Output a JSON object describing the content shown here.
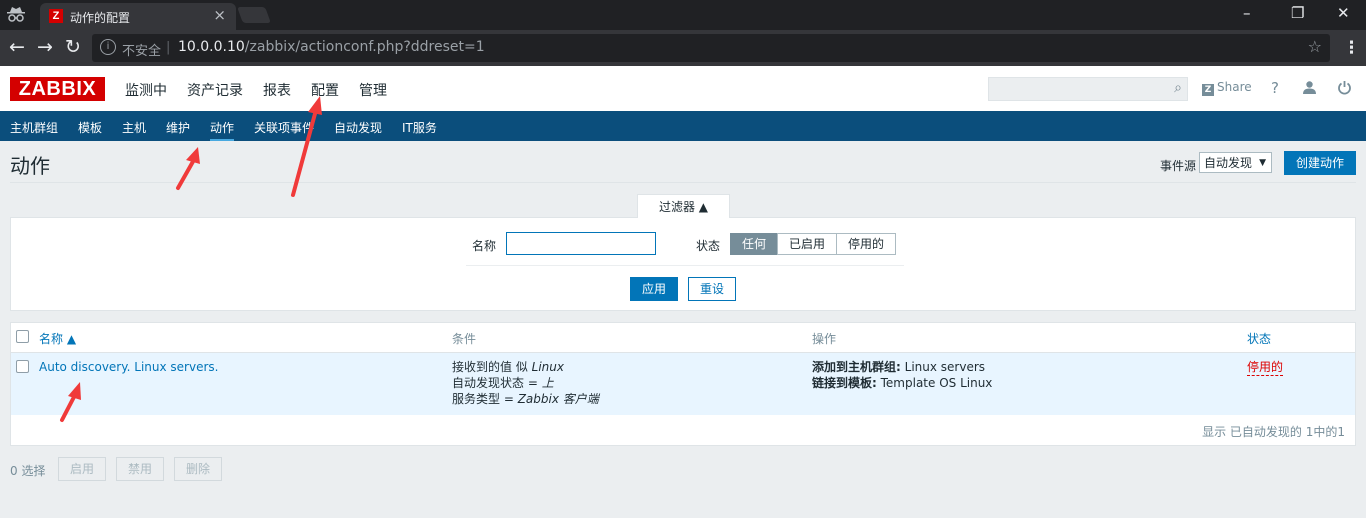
{
  "browser": {
    "tab_title": "动作的配置",
    "favicon_letter": "Z",
    "tab_close": "×",
    "url_security": "不安全",
    "url_host": "10.0.0.10",
    "url_path": "/zabbix/actionconf.php?ddreset=1",
    "window_controls": [
      "–",
      "❐",
      "✕"
    ]
  },
  "header": {
    "logo": "ZABBIX",
    "menu": [
      "监测中",
      "资产记录",
      "报表",
      "配置",
      "管理"
    ],
    "share": "Share",
    "share_icon": "Z",
    "help": "?"
  },
  "subnav": {
    "items": [
      "主机群组",
      "模板",
      "主机",
      "维护",
      "动作",
      "关联项事件",
      "自动发现",
      "IT服务"
    ],
    "active": "动作"
  },
  "page": {
    "title": "动作",
    "event_source_label": "事件源",
    "event_source_value": "自动发现",
    "create_button": "创建动作"
  },
  "filter": {
    "tab_label": "过滤器 ▲",
    "name_label": "名称",
    "name_value": "",
    "status_label": "状态",
    "status_options": [
      "任何",
      "已启用",
      "停用的"
    ],
    "status_selected": "任何",
    "apply": "应用",
    "reset": "重设"
  },
  "table": {
    "columns": [
      "名称 ▲",
      "条件",
      "操作",
      "状态"
    ],
    "rows": [
      {
        "name": "Auto discovery. Linux servers.",
        "conditions": [
          {
            "text": "接收到的值 似 ",
            "value": "Linux"
          },
          {
            "text": "自动发现状态 = ",
            "value": "上"
          },
          {
            "text": "服务类型 = ",
            "value": "Zabbix 客户端"
          }
        ],
        "operations": [
          {
            "label": "添加到主机群组:",
            "value": " Linux servers"
          },
          {
            "label": "链接到模板:",
            "value": " Template OS Linux"
          }
        ],
        "status": "停用的"
      }
    ],
    "footer": "显示 已自动发现的 1中的1"
  },
  "mass_actions": {
    "selected": "0 选择",
    "buttons": [
      "启用",
      "禁用",
      "删除"
    ]
  },
  "colors": {
    "brand_red": "#d40000",
    "nav_blue": "#0b4e7c",
    "primary": "#0275b8",
    "row_highlight": "#e8f5ff",
    "disabled_status": "#dc0000",
    "annotation_arrow": "#f03a3a"
  }
}
